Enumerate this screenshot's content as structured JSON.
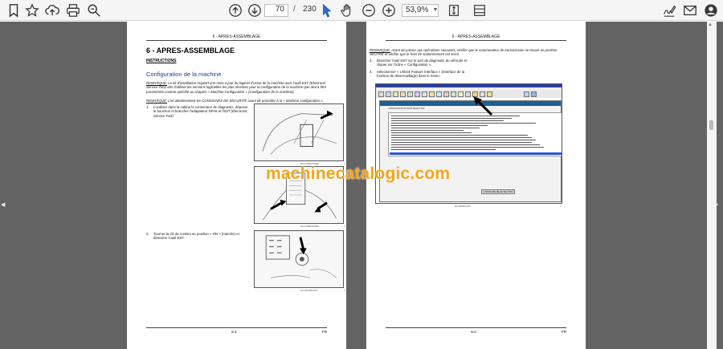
{
  "toolbar": {
    "page_current": "70",
    "page_separator": "/",
    "page_total": "230",
    "zoom": "53,9%",
    "icons": [
      "bookmark-icon",
      "star-icon",
      "upload-icon",
      "print-icon",
      "zoom-search-icon",
      "arrow-up-circle-icon",
      "arrow-down-circle-icon",
      "select-cursor-icon",
      "hand-tool-icon",
      "zoom-out-icon",
      "zoom-in-icon",
      "fit-page-icon",
      "scroll-mode-icon",
      "signature-icon",
      "mail-icon",
      "account-icon"
    ]
  },
  "page_left": {
    "header": "6 - APRES-ASSEMBLAGE",
    "title": "6 - APRES-ASSEMBLAGE",
    "subtitle": "INSTRUCTIONS",
    "section": "Configuration de la machine",
    "remark_label": "REMARQUE:",
    "remark_text": " Le kit d'installation requiert une mise à jour du logiciel d'usine de la machine avec l'outil EST (Electronic Service Tool) afin d'utiliser les versions logicielles les plus récentes pour la configuration de la machine que devra être paramétrée comme spécifié au chapitre « Machine configuration » (Configuration de la machine).",
    "remark2_label": "REMARQUE:",
    "remark2_text": " Lire attentivement les CONSIGNES DE SÉCURITÉ avant de procéder à la « Machine configuration ».",
    "step1_num": "1.",
    "step1_text": "Localiser dans la cabine le connecteur de diagnostic, déposer le bouchon et brancher l'adaptateur DPA5 et l'EST (Electronic Service Tool)",
    "step2_num": "2.",
    "step2_text": "Tourner la clé de contact en position « ON » (marche) et démarrer l'outil EST.",
    "fig_captions": [
      "RCL17DBC00368B",
      "RCL17DBC00366B",
      "RCL18UDBC0015"
    ],
    "fig_numbers": [
      "1",
      "2",
      "3"
    ],
    "footer_page": "6-1",
    "footer_lang": "FR"
  },
  "page_right": {
    "header": "6 - APRES-ASSEMBLAGE",
    "remark_label": "REMARQUE:",
    "remark_text": " Avant de passer aux opérations suivantes, vérifier que le commutateur de transmission se trouve en position NEUTRE et vérifier que le frein de stationnement est serré.",
    "step3_num": "3.",
    "step3_text": "Brancher l'outil EST sur le port de diagnostic du véhicule et cliquer sur l'icône « Configuration ».",
    "step4_num": "4.",
    "step4_text": "Sélectionner « Unlock Feature Interface » (Interface de la fonction de déverrouillage) dans le menu.",
    "dialog_title": "CONFIGURATION FROM SELECTION",
    "dialog_button": "CONFIGURE SELECTED ITEM",
    "shot_caption": "RCL18DBC0075",
    "shot_number": "4",
    "footer_page": "6-2",
    "footer_lang": "FR"
  },
  "watermark": "machinecatalogic.com",
  "colors": {
    "viewer_bg": "#636363",
    "toolbar_bg": "#f5f5f5",
    "watermark": "#f2a61a",
    "section_blue": "#1a3d99"
  }
}
